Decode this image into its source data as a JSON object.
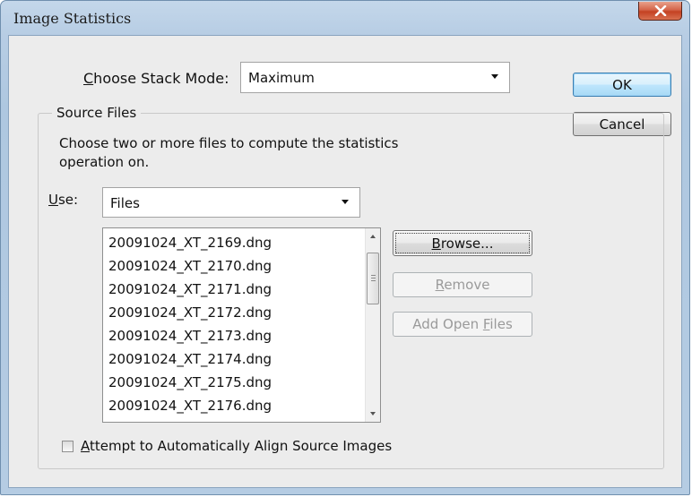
{
  "window": {
    "title": "Image Statistics"
  },
  "stack_mode": {
    "label": "Choose Stack Mode:",
    "label_mnemonic": "C",
    "label_rest": "hoose Stack Mode:",
    "value": "Maximum"
  },
  "source_files": {
    "legend": "Source Files",
    "description_line1": "Choose two or more files to compute the statistics",
    "description_line2": "operation on.",
    "use_label_mnemonic": "U",
    "use_label_rest": "se:",
    "use_value": "Files",
    "files": [
      "20091024_XT_2169.dng",
      "20091024_XT_2170.dng",
      "20091024_XT_2171.dng",
      "20091024_XT_2172.dng",
      "20091024_XT_2173.dng",
      "20091024_XT_2174.dng",
      "20091024_XT_2175.dng",
      "20091024_XT_2176.dng"
    ],
    "browse_mnemonic": "B",
    "browse_rest": "rowse...",
    "remove_mnemonic": "R",
    "remove_rest": "emove",
    "add_open_prefix": "Add Open ",
    "add_open_mnemonic": "F",
    "add_open_rest": "iles",
    "align_mnemonic": "A",
    "align_rest": "ttempt to Automatically Align Source Images"
  },
  "buttons": {
    "ok": "OK",
    "cancel": "Cancel"
  }
}
